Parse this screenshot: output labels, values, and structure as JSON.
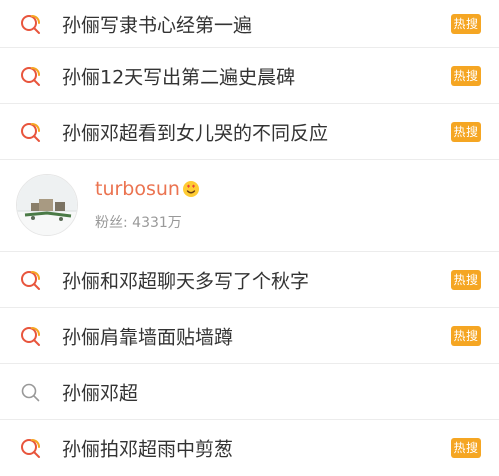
{
  "hot_label": "热搜",
  "rows": [
    {
      "text": "孙俪写隶书心经第一遍",
      "hot": true,
      "icon": "hot-search-icon"
    },
    {
      "text": "孙俪12天写出第二遍史晨碑",
      "hot": true,
      "icon": "hot-search-icon"
    },
    {
      "text": "孙俪邓超看到女儿哭的不同反应",
      "hot": true,
      "icon": "hot-search-icon"
    }
  ],
  "user": {
    "name": "turbosun",
    "fans_label": "粉丝: 4331万",
    "emoji": "heart-eyes-emoji"
  },
  "rows2": [
    {
      "text": "孙俪和邓超聊天多写了个秋字",
      "hot": true,
      "icon": "hot-search-icon"
    },
    {
      "text": "孙俪肩靠墙面贴墙蹲",
      "hot": true,
      "icon": "hot-search-icon"
    },
    {
      "text": "孙俪邓超",
      "hot": false,
      "icon": "search-icon"
    },
    {
      "text": "孙俪拍邓超雨中剪葱",
      "hot": true,
      "icon": "hot-search-icon"
    }
  ],
  "colors": {
    "accent": "#f5a623",
    "username": "#eb7350",
    "hot_search_icon": "#e8553d",
    "plain_search_icon": "#999999"
  }
}
